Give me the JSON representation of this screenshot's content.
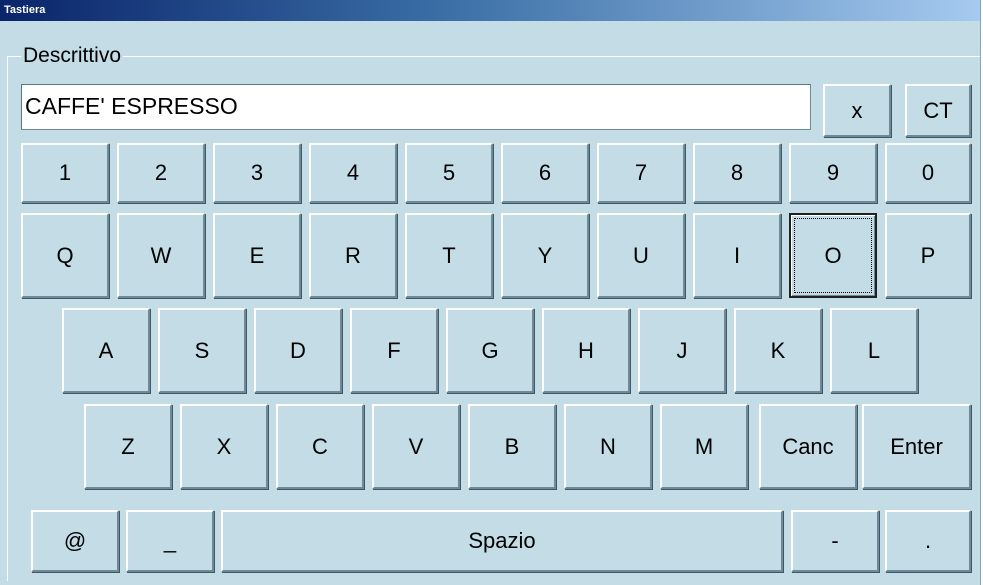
{
  "window": {
    "title": "Tastiera"
  },
  "field": {
    "label": "Descrittivo",
    "value": "CAFFE' ESPRESSO"
  },
  "controls": {
    "clear_label": "x",
    "ct_label": "CT"
  },
  "row1": [
    "1",
    "2",
    "3",
    "4",
    "5",
    "6",
    "7",
    "8",
    "9",
    "0"
  ],
  "row2": [
    "Q",
    "W",
    "E",
    "R",
    "T",
    "Y",
    "U",
    "I",
    "O",
    "P"
  ],
  "row3": [
    "A",
    "S",
    "D",
    "F",
    "G",
    "H",
    "J",
    "K",
    "L"
  ],
  "row4": [
    "Z",
    "X",
    "C",
    "V",
    "B",
    "N",
    "M",
    "Canc",
    "Enter"
  ],
  "bottom": {
    "at": "@",
    "underscore": "_",
    "space": "Spazio",
    "dash": "-",
    "dot": "."
  },
  "focused_key": "O"
}
